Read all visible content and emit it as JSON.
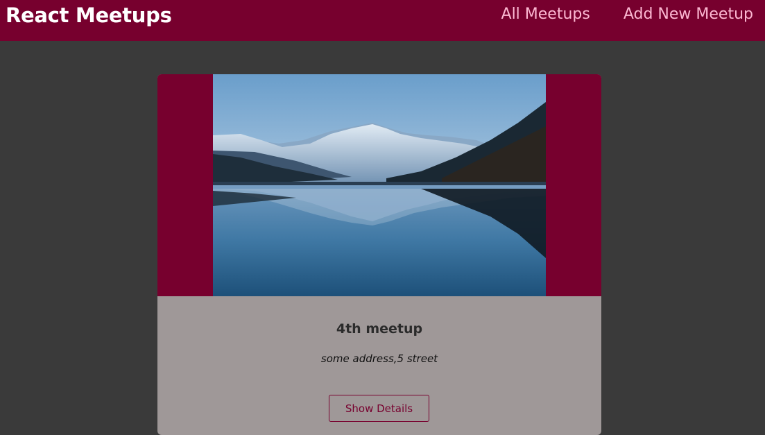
{
  "header": {
    "logo": "React Meetups",
    "nav": [
      {
        "label": "All Meetups"
      },
      {
        "label": "Add New Meetup"
      }
    ]
  },
  "meetup": {
    "title": "4th meetup",
    "address": "some address,5 street",
    "details_label": "Show Details",
    "image_icon": "mountain-lake-photo"
  },
  "colors": {
    "brand": "#77002e",
    "nav_link": "#fcb8d2",
    "page_bg": "#3a3a3a",
    "card_bg": "#9f9898"
  }
}
